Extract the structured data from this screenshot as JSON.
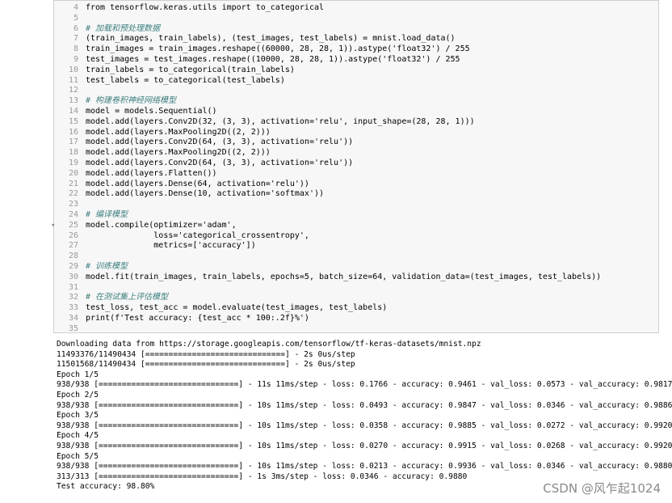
{
  "code_lines": [
    {
      "n": "4",
      "t": "from tensorflow.keras.utils import to_categorical"
    },
    {
      "n": "5",
      "t": ""
    },
    {
      "n": "6",
      "t": "# 加载和预处理数据"
    },
    {
      "n": "7",
      "t": "(train_images, train_labels), (test_images, test_labels) = mnist.load_data()"
    },
    {
      "n": "8",
      "t": "train_images = train_images.reshape((60000, 28, 28, 1)).astype('float32') / 255"
    },
    {
      "n": "9",
      "t": "test_images = test_images.reshape((10000, 28, 28, 1)).astype('float32') / 255"
    },
    {
      "n": "10",
      "t": "train_labels = to_categorical(train_labels)"
    },
    {
      "n": "11",
      "t": "test_labels = to_categorical(test_labels)"
    },
    {
      "n": "12",
      "t": ""
    },
    {
      "n": "13",
      "t": "# 构建卷积神经网络模型"
    },
    {
      "n": "14",
      "t": "model = models.Sequential()"
    },
    {
      "n": "15",
      "t": "model.add(layers.Conv2D(32, (3, 3), activation='relu', input_shape=(28, 28, 1)))"
    },
    {
      "n": "16",
      "t": "model.add(layers.MaxPooling2D((2, 2)))"
    },
    {
      "n": "17",
      "t": "model.add(layers.Conv2D(64, (3, 3), activation='relu'))"
    },
    {
      "n": "18",
      "t": "model.add(layers.MaxPooling2D((2, 2)))"
    },
    {
      "n": "19",
      "t": "model.add(layers.Conv2D(64, (3, 3), activation='relu'))"
    },
    {
      "n": "20",
      "t": "model.add(layers.Flatten())"
    },
    {
      "n": "21",
      "t": "model.add(layers.Dense(64, activation='relu'))"
    },
    {
      "n": "22",
      "t": "model.add(layers.Dense(10, activation='softmax'))"
    },
    {
      "n": "23",
      "t": ""
    },
    {
      "n": "24",
      "t": "# 编译模型"
    },
    {
      "n": "25",
      "t": "model.compile(optimizer='adam',"
    },
    {
      "n": "26",
      "t": "              loss='categorical_crossentropy',"
    },
    {
      "n": "27",
      "t": "              metrics=['accuracy'])"
    },
    {
      "n": "28",
      "t": ""
    },
    {
      "n": "29",
      "t": "# 训练模型"
    },
    {
      "n": "30",
      "t": "model.fit(train_images, train_labels, epochs=5, batch_size=64, validation_data=(test_images, test_labels))"
    },
    {
      "n": "31",
      "t": ""
    },
    {
      "n": "32",
      "t": "# 在测试集上评估模型"
    },
    {
      "n": "33",
      "t": "test_loss, test_acc = model.evaluate(test_images, test_labels)"
    },
    {
      "n": "34",
      "t": "print(f'Test accuracy: {test_acc * 100:.2f}%')"
    },
    {
      "n": "35",
      "t": ""
    }
  ],
  "output_lines": [
    "Downloading data from https://storage.googleapis.com/tensorflow/tf-keras-datasets/mnist.npz",
    "11493376/11490434 [==============================] - 2s 0us/step",
    "11501568/11490434 [==============================] - 2s 0us/step",
    "Epoch 1/5",
    "938/938 [==============================] - 11s 11ms/step - loss: 0.1766 - accuracy: 0.9461 - val_loss: 0.0573 - val_accuracy: 0.9817",
    "Epoch 2/5",
    "938/938 [==============================] - 10s 11ms/step - loss: 0.0493 - accuracy: 0.9847 - val_loss: 0.0346 - val_accuracy: 0.9886",
    "Epoch 3/5",
    "938/938 [==============================] - 10s 11ms/step - loss: 0.0358 - accuracy: 0.9885 - val_loss: 0.0272 - val_accuracy: 0.9920",
    "Epoch 4/5",
    "938/938 [==============================] - 10s 11ms/step - loss: 0.0270 - accuracy: 0.9915 - val_loss: 0.0268 - val_accuracy: 0.9920",
    "Epoch 5/5",
    "938/938 [==============================] - 10s 11ms/step - loss: 0.0213 - accuracy: 0.9936 - val_loss: 0.0346 - val_accuracy: 0.9880",
    "313/313 [==============================] - 1s 3ms/step - loss: 0.0346 - accuracy: 0.9880",
    "Test accuracy: 98.80%"
  ],
  "watermark": "CSDN @风乍起1024"
}
